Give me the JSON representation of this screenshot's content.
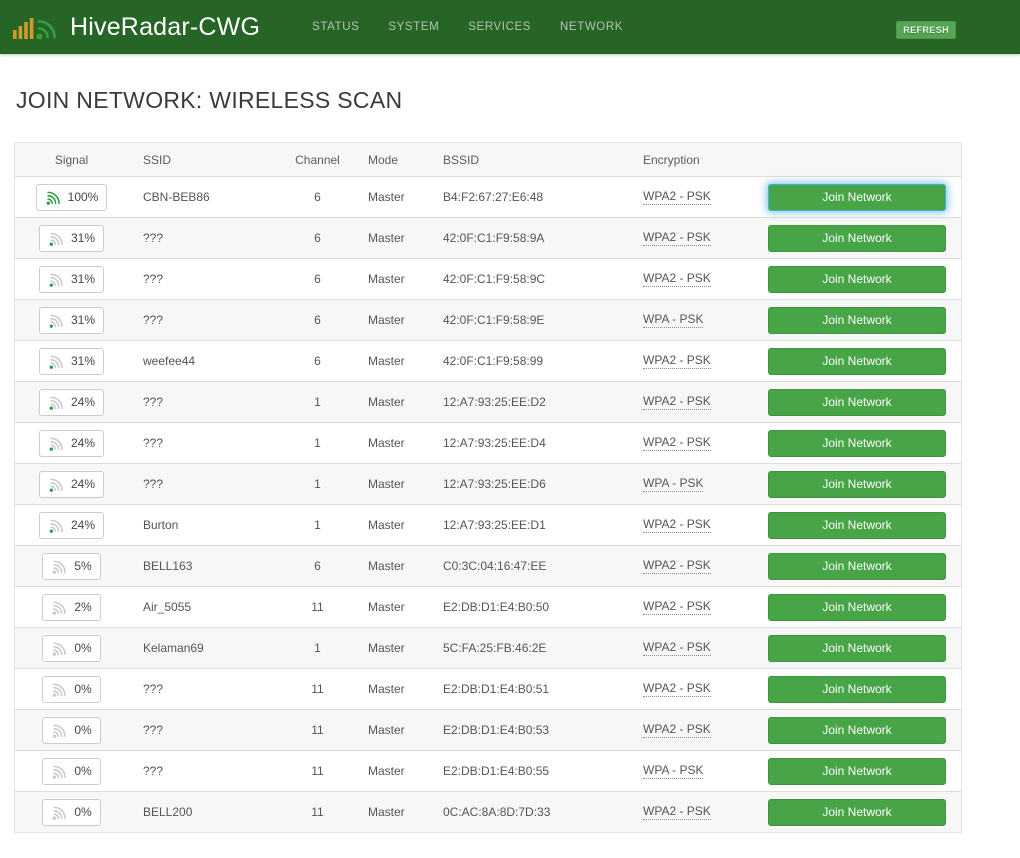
{
  "header": {
    "brand": "HiveRadar-CWG",
    "nav": [
      {
        "label": "STATUS"
      },
      {
        "label": "SYSTEM"
      },
      {
        "label": "SERVICES"
      },
      {
        "label": "NETWORK"
      }
    ],
    "refresh_label": "REFRESH"
  },
  "page_title": "JOIN NETWORK: WIRELESS SCAN",
  "colors": {
    "topbar_green": "#276527",
    "button_green": "#47a447",
    "refresh_green": "#55a555",
    "signal_green": "#2a9c42",
    "signal_gray": "#c9c9c9",
    "logo_bars_amber": "#d09b2b",
    "focus_ring_blue": "#39b3d7",
    "stripe_gray": "#f7f7f7"
  },
  "table": {
    "columns": [
      "Signal",
      "SSID",
      "Channel",
      "Mode",
      "BSSID",
      "Encryption"
    ],
    "join_button_label": "Join Network",
    "rows": [
      {
        "signal": "100%",
        "signal_level": "full",
        "ssid": "CBN-BEB86",
        "channel": "6",
        "mode": "Master",
        "bssid": "B4:F2:67:27:E6:48",
        "encryption": "WPA2 - PSK",
        "focused": true
      },
      {
        "signal": "31%",
        "signal_level": "low",
        "ssid": "???",
        "channel": "6",
        "mode": "Master",
        "bssid": "42:0F:C1:F9:58:9A",
        "encryption": "WPA2 - PSK",
        "focused": false
      },
      {
        "signal": "31%",
        "signal_level": "low",
        "ssid": "???",
        "channel": "6",
        "mode": "Master",
        "bssid": "42:0F:C1:F9:58:9C",
        "encryption": "WPA2 - PSK",
        "focused": false
      },
      {
        "signal": "31%",
        "signal_level": "low",
        "ssid": "???",
        "channel": "6",
        "mode": "Master",
        "bssid": "42:0F:C1:F9:58:9E",
        "encryption": "WPA - PSK",
        "focused": false
      },
      {
        "signal": "31%",
        "signal_level": "low",
        "ssid": "weefee44",
        "channel": "6",
        "mode": "Master",
        "bssid": "42:0F:C1:F9:58:99",
        "encryption": "WPA2 - PSK",
        "focused": false
      },
      {
        "signal": "24%",
        "signal_level": "low",
        "ssid": "???",
        "channel": "1",
        "mode": "Master",
        "bssid": "12:A7:93:25:EE:D2",
        "encryption": "WPA2 - PSK",
        "focused": false
      },
      {
        "signal": "24%",
        "signal_level": "low",
        "ssid": "???",
        "channel": "1",
        "mode": "Master",
        "bssid": "12:A7:93:25:EE:D4",
        "encryption": "WPA2 - PSK",
        "focused": false
      },
      {
        "signal": "24%",
        "signal_level": "low",
        "ssid": "???",
        "channel": "1",
        "mode": "Master",
        "bssid": "12:A7:93:25:EE:D6",
        "encryption": "WPA - PSK",
        "focused": false
      },
      {
        "signal": "24%",
        "signal_level": "low",
        "ssid": "Burton",
        "channel": "1",
        "mode": "Master",
        "bssid": "12:A7:93:25:EE:D1",
        "encryption": "WPA2 - PSK",
        "focused": false
      },
      {
        "signal": "5%",
        "signal_level": "none",
        "ssid": "BELL163",
        "channel": "6",
        "mode": "Master",
        "bssid": "C0:3C:04:16:47:EE",
        "encryption": "WPA2 - PSK",
        "focused": false
      },
      {
        "signal": "2%",
        "signal_level": "none",
        "ssid": "Air_5055",
        "channel": "11",
        "mode": "Master",
        "bssid": "E2:DB:D1:E4:B0:50",
        "encryption": "WPA2 - PSK",
        "focused": false
      },
      {
        "signal": "0%",
        "signal_level": "none",
        "ssid": "Kelaman69",
        "channel": "1",
        "mode": "Master",
        "bssid": "5C:FA:25:FB:46:2E",
        "encryption": "WPA2 - PSK",
        "focused": false
      },
      {
        "signal": "0%",
        "signal_level": "none",
        "ssid": "???",
        "channel": "11",
        "mode": "Master",
        "bssid": "E2:DB:D1:E4:B0:51",
        "encryption": "WPA2 - PSK",
        "focused": false
      },
      {
        "signal": "0%",
        "signal_level": "none",
        "ssid": "???",
        "channel": "11",
        "mode": "Master",
        "bssid": "E2:DB:D1:E4:B0:53",
        "encryption": "WPA2 - PSK",
        "focused": false
      },
      {
        "signal": "0%",
        "signal_level": "none",
        "ssid": "???",
        "channel": "11",
        "mode": "Master",
        "bssid": "E2:DB:D1:E4:B0:55",
        "encryption": "WPA - PSK",
        "focused": false
      },
      {
        "signal": "0%",
        "signal_level": "none",
        "ssid": "BELL200",
        "channel": "11",
        "mode": "Master",
        "bssid": "0C:AC:8A:8D:7D:33",
        "encryption": "WPA2 - PSK",
        "focused": false
      }
    ]
  }
}
